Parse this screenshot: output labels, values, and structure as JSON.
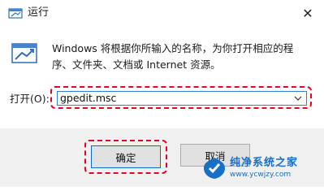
{
  "window": {
    "title": "运行",
    "close_glyph": "✕"
  },
  "dialog": {
    "description": "Windows 将根据你所输入的名称，为你打开相应的程序、文件夹、文档或 Internet 资源。",
    "open_label": "打开(O):",
    "input_value": "gpedit.msc"
  },
  "buttons": {
    "ok_label": "确定",
    "cancel_label": "取消"
  },
  "watermark": {
    "name": "纯净系统之家",
    "url": "www.ycwjzy.com"
  },
  "colors": {
    "highlight": "#e4002b",
    "focus": "#2d7fd3",
    "watermark": "#1670c7"
  },
  "icons": [
    "run-app-icon",
    "close-icon",
    "run-large-icon",
    "chevron-down-icon",
    "watermark-logo-icon"
  ]
}
